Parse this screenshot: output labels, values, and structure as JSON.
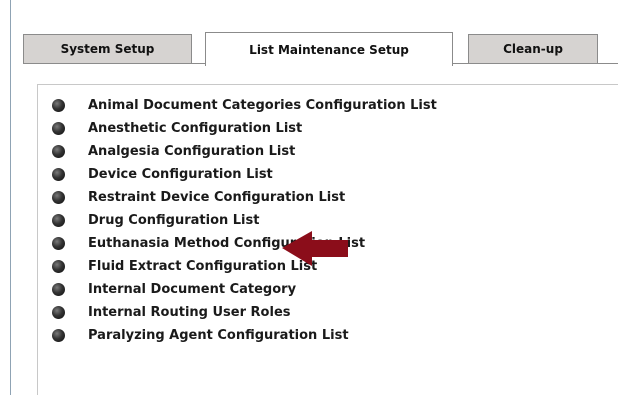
{
  "tabs": [
    {
      "label": "System Setup",
      "active": false
    },
    {
      "label": "List Maintenance Setup",
      "active": true
    },
    {
      "label": "Clean-up",
      "active": false
    }
  ],
  "config_list": {
    "bullet_icon": "round-bullet-icon",
    "items": [
      "Animal Document Categories Configuration List",
      "Anesthetic Configuration List",
      "Analgesia Configuration List",
      "Device Configuration List",
      "Restraint Device Configuration List",
      "Drug Configuration List",
      "Euthanasia Method Configuration List",
      "Fluid Extract Configuration List",
      "Internal Document Category",
      "Internal Routing User Roles",
      "Paralyzing Agent Configuration List"
    ]
  },
  "annotation": {
    "icon": "left-arrow-icon",
    "color": "#8b0d1a",
    "points_to": "Drug Configuration List"
  }
}
